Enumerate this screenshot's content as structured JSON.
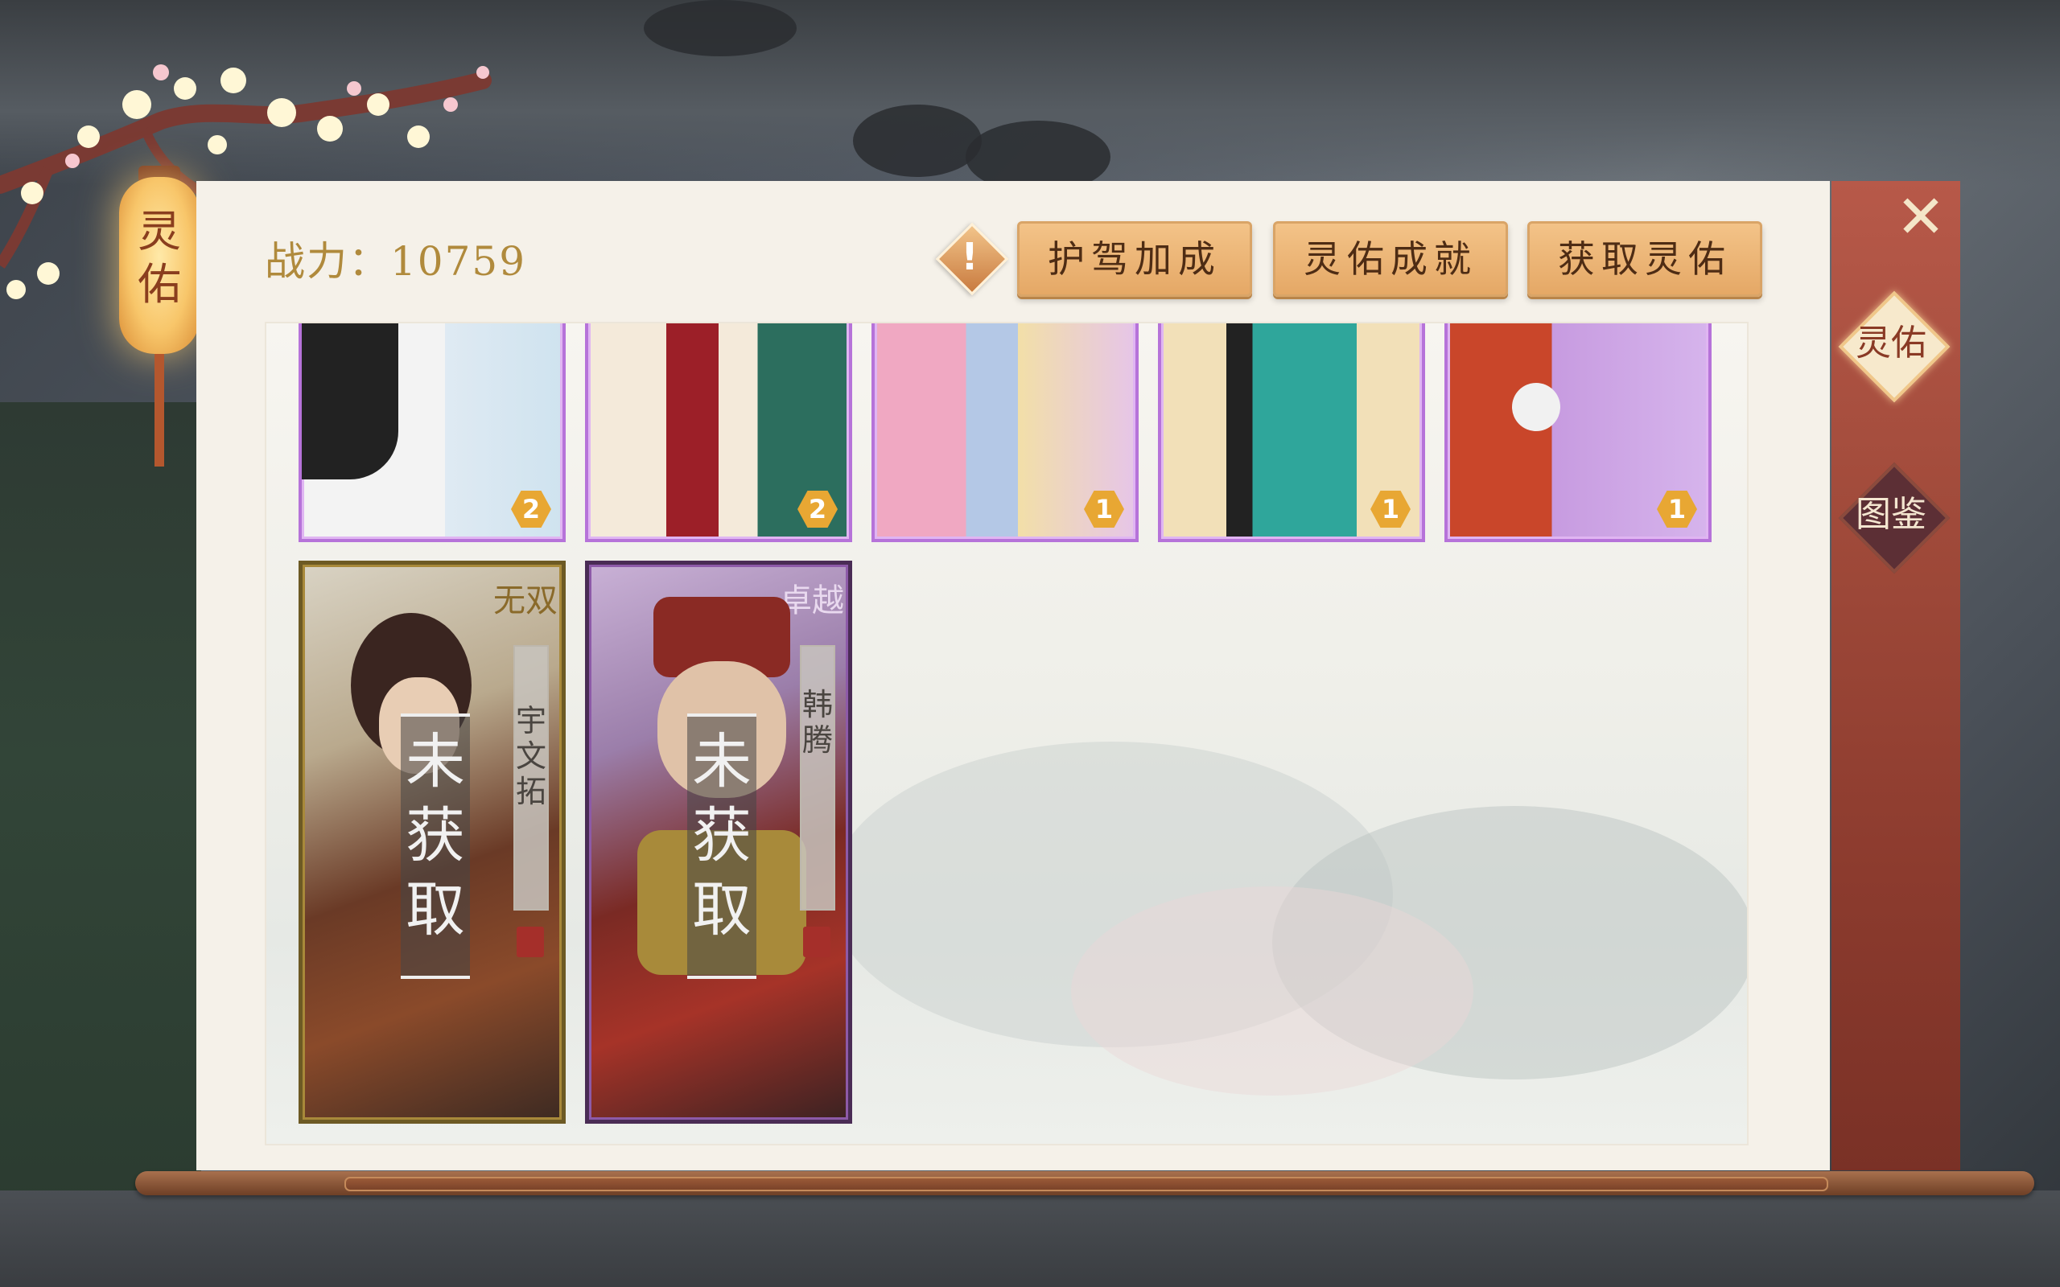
{
  "lantern": {
    "label": "灵佑"
  },
  "header": {
    "power_label": "战力：",
    "power_value": "10759"
  },
  "toolbar": {
    "info_icon": "exclamation-icon",
    "buttons": [
      {
        "label": "护驾加成"
      },
      {
        "label": "灵佑成就"
      },
      {
        "label": "获取灵佑"
      }
    ]
  },
  "side_tabs": [
    {
      "label": "灵佑",
      "active": true
    },
    {
      "label": "图鉴",
      "active": false
    }
  ],
  "top_cards": [
    {
      "level": "2",
      "bg": "#dfeaf3",
      "accent": "#ffffff"
    },
    {
      "level": "2",
      "bg": "#2c6e5e",
      "accent": "#9c1f28"
    },
    {
      "level": "1",
      "bg": "#e6c5e8",
      "accent": "#f0a8c2"
    },
    {
      "level": "1",
      "bg": "#f2e0b8",
      "accent": "#2fa69b"
    },
    {
      "level": "1",
      "bg": "#c79be0",
      "accent": "#c9462a"
    }
  ],
  "locked_cards": [
    {
      "name": "宇文拓",
      "status": "未获取",
      "badge": "无双",
      "frame": "gold"
    },
    {
      "name": "韩腾",
      "status": "未获取",
      "badge": "卓越",
      "frame": "purple"
    }
  ],
  "colors": {
    "gold": "#b08a3c",
    "button": "#e5a866",
    "rail": "#a04a3a",
    "purple_frame": "#b673d9"
  }
}
